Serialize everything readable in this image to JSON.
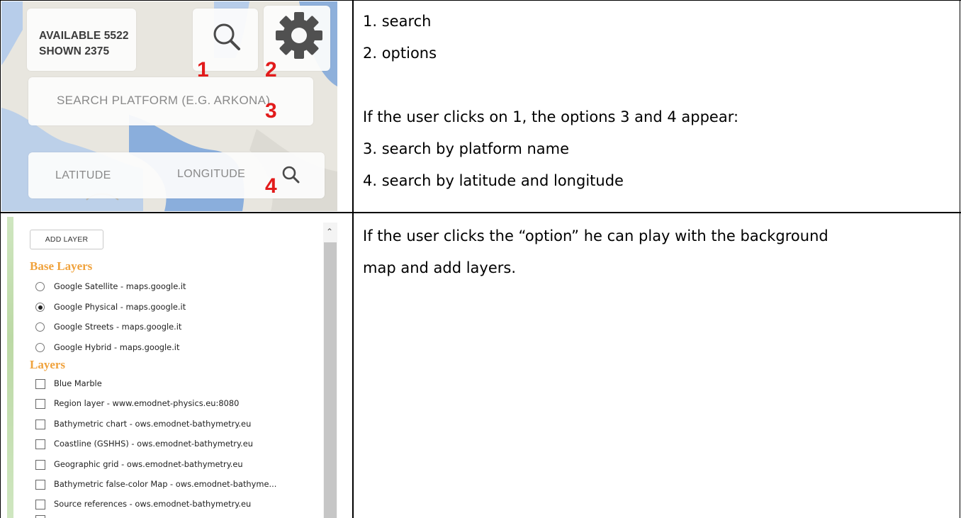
{
  "map_widget": {
    "available": "AVAILABLE 5522",
    "shown": "SHOWN 2375",
    "search_placeholder": "SEARCH PLATFORM (E.G. ARKONA)",
    "latitude_placeholder": "LATITUDE",
    "longitude_placeholder": "LONGITUDE",
    "markers": [
      "1",
      "2",
      "3",
      "4"
    ]
  },
  "description_top": {
    "lines": [
      "1.  search",
      "2. options",
      "If the user clicks on 1, the options 3 and 4 appear:",
      "3.  search by platform name",
      "4. search by latitude and longitude"
    ]
  },
  "layer_panel": {
    "add_layer": "ADD LAYER",
    "base_layers_title": "Base Layers",
    "base_layers": [
      {
        "label": "Google Satellite - maps.google.it",
        "selected": false
      },
      {
        "label": "Google Physical - maps.google.it",
        "selected": true
      },
      {
        "label": "Google Streets - maps.google.it",
        "selected": false
      },
      {
        "label": "Google Hybrid - maps.google.it",
        "selected": false
      }
    ],
    "layers_title": "Layers",
    "layers": [
      {
        "label": "Blue Marble",
        "checked": false
      },
      {
        "label": "Region layer - www.emodnet-physics.eu:8080",
        "checked": false
      },
      {
        "label": "Bathymetric chart - ows.emodnet-bathymetry.eu",
        "checked": false
      },
      {
        "label": "Coastline (GSHHS) - ows.emodnet-bathymetry.eu",
        "checked": false
      },
      {
        "label": "Geographic grid - ows.emodnet-bathymetry.eu",
        "checked": false
      },
      {
        "label": "Bathymetric false-color Map - ows.emodnet-bathyme...",
        "checked": false
      },
      {
        "label": "Source references - ows.emodnet-bathymetry.eu",
        "checked": false
      }
    ]
  },
  "description_bottom": {
    "lines": [
      "If the user clicks the “option” he can play with the background",
      "map and add layers."
    ]
  },
  "colors": {
    "marker_red": "#e21b1b",
    "section_orange": "#f0a23c",
    "water_blue": "#6a9bd8",
    "land": "#e9e7e0"
  }
}
